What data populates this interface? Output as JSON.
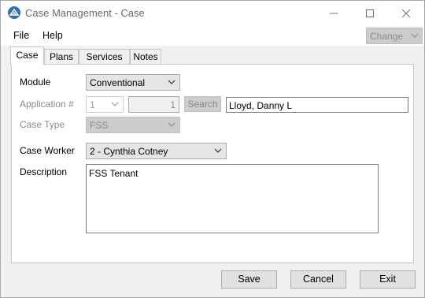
{
  "window": {
    "title": "Case Management - Case"
  },
  "menu": {
    "file": "File",
    "help": "Help",
    "change_value": "Change"
  },
  "tabs": [
    {
      "label": "Case",
      "active": true
    },
    {
      "label": "Plans",
      "active": false
    },
    {
      "label": "Services",
      "active": false
    },
    {
      "label": "Notes",
      "active": false
    }
  ],
  "form": {
    "module_label": "Module",
    "module_value": "Conventional",
    "application_label": "Application #",
    "application_combo_value": "1",
    "application_number": "1",
    "search_label": "Search",
    "applicant_name": "Lloyd, Danny L",
    "case_type_label": "Case Type",
    "case_type_value": "FSS",
    "case_worker_label": "Case Worker",
    "case_worker_value": "2 - Cynthia Cotney",
    "description_label": "Description",
    "description_value": "FSS Tenant"
  },
  "buttons": {
    "save": "Save",
    "cancel": "Cancel",
    "exit": "Exit"
  },
  "colors": {
    "accent": "#2f6fb3",
    "window_bg": "#f0f0f0",
    "disabled_bg": "#cccccc"
  },
  "icons": {
    "app": "app-logo-icon",
    "minimize": "minimize-icon",
    "maximize": "maximize-icon",
    "close": "close-icon",
    "dropdown": "chevron-down-icon"
  }
}
